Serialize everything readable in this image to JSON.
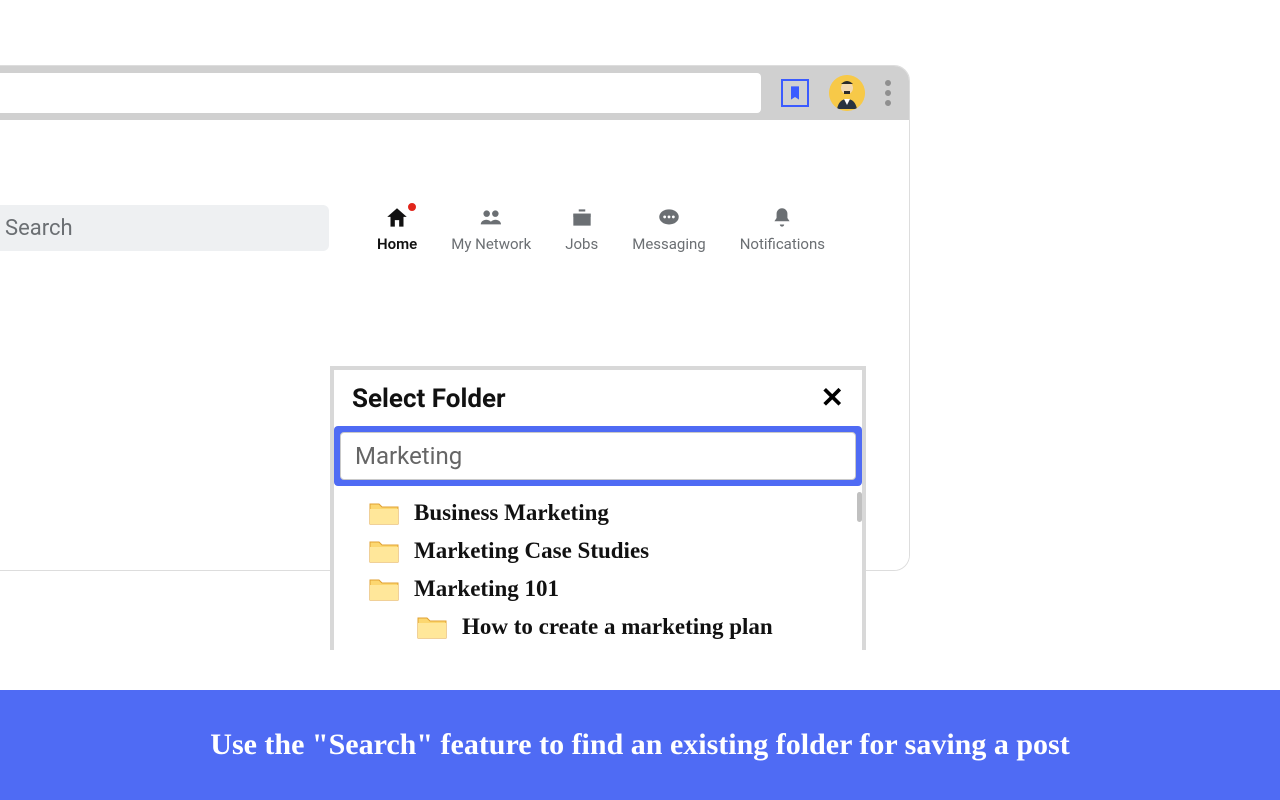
{
  "toolbar": {
    "bookmark_icon": "bookmark",
    "avatar_icon": "avatar",
    "kebab_icon": "more"
  },
  "nav": {
    "search_placeholder": "Search",
    "items": [
      {
        "label": "Home",
        "icon": "home",
        "active": true,
        "badge": true
      },
      {
        "label": "My Network",
        "icon": "people",
        "active": false,
        "badge": false
      },
      {
        "label": "Jobs",
        "icon": "briefcase",
        "active": false,
        "badge": false
      },
      {
        "label": "Messaging",
        "icon": "chat",
        "active": false,
        "badge": false
      },
      {
        "label": "Notifications",
        "icon": "bell",
        "active": false,
        "badge": false
      }
    ]
  },
  "modal": {
    "title": "Select Folder",
    "search_value": "Marketing",
    "folders": [
      {
        "name": "Business Marketing",
        "level": 0
      },
      {
        "name": "Marketing Case Studies",
        "level": 0
      },
      {
        "name": "Marketing 101",
        "level": 0
      },
      {
        "name": "How to create a marketing plan",
        "level": 1
      }
    ]
  },
  "caption": "Use the \"Search\" feature to find an existing folder for saving a post"
}
